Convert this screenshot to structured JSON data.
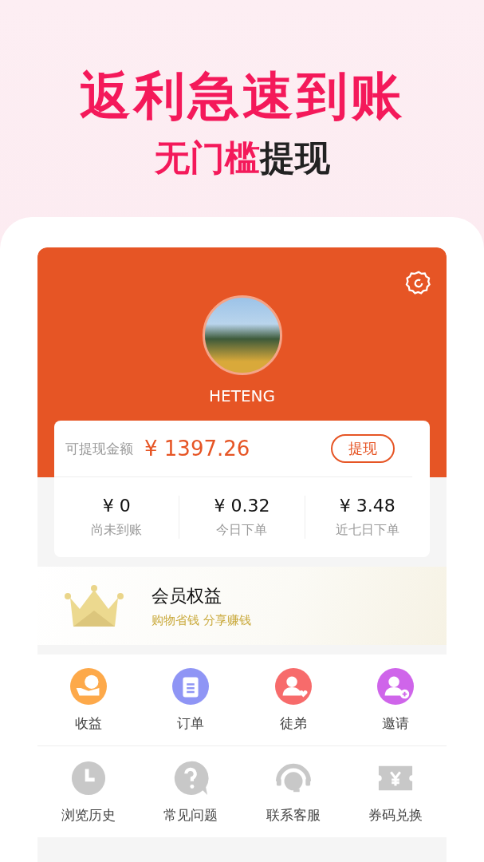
{
  "headline": {
    "title": "返利急速到账",
    "highlight": "无门槛",
    "rest": "提现"
  },
  "profile": {
    "username": "HETENG"
  },
  "balance": {
    "label": "可提现金额",
    "amount": "¥ 1397.26",
    "button": "提现"
  },
  "stats": [
    {
      "value": "¥ 0",
      "label": "尚未到账"
    },
    {
      "value": "¥ 0.32",
      "label": "今日下单"
    },
    {
      "value": "¥ 3.48",
      "label": "近七日下单"
    }
  ],
  "membership": {
    "title": "会员权益",
    "subtitle": "购物省钱 分享赚钱"
  },
  "menu_rows": [
    [
      {
        "label": "收益",
        "color": "#fda94a"
      },
      {
        "label": "订单",
        "color": "#8f95f5"
      },
      {
        "label": "徒弟",
        "color": "#f76b6b"
      },
      {
        "label": "邀请",
        "color": "#cf65ea"
      }
    ],
    [
      {
        "label": "浏览历史",
        "color": "#c8c8c8"
      },
      {
        "label": "常见问题",
        "color": "#c8c8c8"
      },
      {
        "label": "联系客服",
        "color": "#c8c8c8"
      },
      {
        "label": "券码兑换",
        "color": "#c8c8c8"
      }
    ]
  ]
}
